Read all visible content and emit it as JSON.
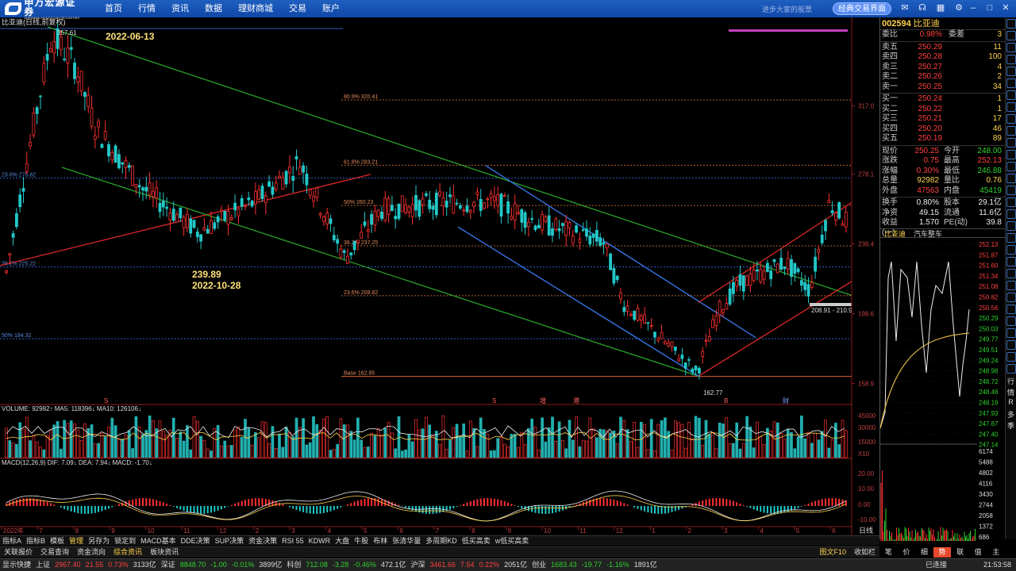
{
  "app": {
    "logo_name": "申万宏源证券",
    "logo_sub": "SHENWAN HONGYUAN SECURITIES",
    "nav": [
      "首页",
      "行情",
      "资讯",
      "数据",
      "理财商城",
      "交易",
      "账户"
    ],
    "slogan": "进步大家的股票",
    "classic_button": "经典交易界面",
    "icons": [
      "message-icon",
      "headset-icon",
      "grid-icon",
      "settings-icon",
      "minimize-icon",
      "maximize-icon",
      "close-icon"
    ]
  },
  "chart_header": "比亚迪(日线,前复权)",
  "chart_data": {
    "type": "candlestick",
    "annotations": {
      "high_label": "357.61",
      "high_date": "2022-06-13",
      "low_label": "239.89",
      "low_date": "2022-10-28",
      "bottom_label": "162.77",
      "range_label": "208.91 - 210.9"
    },
    "fib_levels": [
      {
        "label": "80.9% 320.41",
        "value": 320.41
      },
      {
        "label": "61.8% 283.21",
        "value": 283.21
      },
      {
        "label": "50% 260.23",
        "value": 260.23
      },
      {
        "label": "38.2% 237.25",
        "value": 237.25
      },
      {
        "label": "23.6% 208.82",
        "value": 208.82
      },
      {
        "label": "Base 162.85",
        "value": 162.85
      }
    ],
    "left_levels": [
      {
        "label": "23.6% 275.82",
        "value": 275.82
      },
      {
        "label": "38.2% 225.22",
        "value": 225.22
      },
      {
        "label": "50% 184.32",
        "value": 184.32
      }
    ],
    "y_ticks": [
      "317.0",
      "278.1",
      "238.4",
      "198.6",
      "158.9"
    ],
    "y_ticks_values": [
      317.0,
      278.1,
      238.4,
      198.6,
      158.9
    ],
    "x_months": [
      "2022年",
      "7",
      "8",
      "9",
      "10",
      "11",
      "12",
      "2",
      "3",
      "4",
      "5",
      "6",
      "7",
      "8",
      "9",
      "10",
      "11",
      "12",
      "1",
      "2",
      "3",
      "4",
      "5",
      "6"
    ],
    "ylim": [
      155,
      362
    ],
    "event_marks": [
      "S",
      "S",
      "增",
      "港",
      "B",
      "财"
    ],
    "volume_header": "VOLUME: 92982↑  MA5: 118396↓  MA10: 126106↓",
    "volume_ticks": [
      "45000",
      "30000",
      "15000",
      "X10"
    ],
    "macd_header": "MACD(12,26,9)  DIF: 7.09↓  DEA: 7.94↓  MACD: -1.70↓",
    "macd_ticks": [
      "20.00",
      "10.00",
      "0.00",
      "-10.00"
    ]
  },
  "quote": {
    "code": "002594",
    "name": "比亚迪",
    "weibi": {
      "label": "委比",
      "value": "0.98%",
      "label2": "委差",
      "value2": "3"
    },
    "sells": [
      {
        "label": "卖五",
        "price": "250.29",
        "vol": "11"
      },
      {
        "label": "卖四",
        "price": "250.28",
        "vol": "100"
      },
      {
        "label": "卖三",
        "price": "250.27",
        "vol": "4"
      },
      {
        "label": "卖二",
        "price": "250.26",
        "vol": "2"
      },
      {
        "label": "卖一",
        "price": "250.25",
        "vol": "34"
      }
    ],
    "buys": [
      {
        "label": "买一",
        "price": "250.24",
        "vol": "1"
      },
      {
        "label": "买二",
        "price": "250.22",
        "vol": "1"
      },
      {
        "label": "买三",
        "price": "250.21",
        "vol": "17"
      },
      {
        "label": "买四",
        "price": "250.20",
        "vol": "46"
      },
      {
        "label": "买五",
        "price": "250.19",
        "vol": "89"
      }
    ],
    "stats": [
      {
        "l1": "现价",
        "v1": "250.25",
        "c1": "red",
        "l2": "今开",
        "v2": "248.00",
        "c2": "green"
      },
      {
        "l1": "涨跌",
        "v1": "0.75",
        "c1": "red",
        "l2": "最高",
        "v2": "252.13",
        "c2": "red"
      },
      {
        "l1": "涨幅",
        "v1": "0.30%",
        "c1": "red",
        "l2": "最低",
        "v2": "246.88",
        "c2": "green"
      },
      {
        "l1": "总量",
        "v1": "92982",
        "c1": "yel",
        "l2": "量比",
        "v2": "0.76",
        "c2": "yel"
      },
      {
        "l1": "外盘",
        "v1": "47563",
        "c1": "red",
        "l2": "内盘",
        "v2": "45419",
        "c2": "green"
      }
    ],
    "stats2": [
      {
        "l1": "换手",
        "v1": "0.80%",
        "c1": "wht",
        "l2": "股本",
        "v2": "29.1亿",
        "c2": "wht"
      },
      {
        "l1": "净资",
        "v1": "49.15",
        "c1": "wht",
        "l2": "流通",
        "v2": "11.6亿",
        "c2": "wht"
      },
      {
        "l1": "收益(一)",
        "v1": "1.570",
        "c1": "wht",
        "l2": "PE(动)",
        "v2": "39.8",
        "c2": "wht"
      }
    ],
    "tabs": [
      "比亚迪",
      "汽车整车"
    ],
    "intraday_prices": [
      "252.13",
      "251.87",
      "251.60",
      "251.34",
      "251.08",
      "250.82",
      "250.56",
      "250.29",
      "250.03",
      "249.77",
      "249.51",
      "249.24",
      "248.98",
      "248.72",
      "248.46",
      "248.19",
      "247.93",
      "247.67",
      "247.40",
      "247.14"
    ],
    "intraday_vol": [
      "6174",
      "5488",
      "4802",
      "4116",
      "3430",
      "2744",
      "2058",
      "1372",
      "686"
    ],
    "bottom_tabs": [
      "笔",
      "价",
      "细",
      "势",
      "联",
      "值",
      "主"
    ],
    "active_bottom_tab": "势",
    "timeframe": "日线"
  },
  "bottom_tabs": [
    "指标A",
    "指标B",
    "模板",
    "管理",
    "另存为",
    "锁定到",
    "MACD基本",
    "DDE决策",
    "SUP决策",
    "资金决策",
    "RSI 55",
    "KDWR",
    "大盘",
    "牛股",
    "布林",
    "张清华量",
    "多周期KD",
    "低买高卖",
    "w低买高卖"
  ],
  "info_tabs": [
    "关联报价",
    "交易查询",
    "资金流向",
    "综合资讯",
    "板块资讯"
  ],
  "info_right": [
    "图文F10",
    "收如栏"
  ],
  "status": [
    {
      "name": "上证",
      "value": "2967.40",
      "change": "21.55",
      "pct": "0.73%",
      "amt": "3133亿",
      "dir": "red"
    },
    {
      "name": "深证",
      "value": "8848.70",
      "change": "-1.00",
      "pct": "-0.01%",
      "amt": "3899亿",
      "dir": "green"
    },
    {
      "name": "科创",
      "value": "712.08",
      "change": "-3.28",
      "pct": "-0.46%",
      "amt": "472.1亿",
      "dir": "green"
    },
    {
      "name": "沪深",
      "value": "3461.66",
      "change": "7.54",
      "pct": "0.22%",
      "amt": "2051亿",
      "dir": "red"
    },
    {
      "name": "创业",
      "value": "1683.43",
      "change": "-19.77",
      "pct": "-1.16%",
      "amt": "1891亿",
      "dir": "green"
    }
  ],
  "status_left": "显示快捷",
  "status_right": {
    "connected": "已连接",
    "time": "21:53:58"
  },
  "right_strip": [
    "行",
    "情",
    "R",
    "多",
    "季"
  ]
}
